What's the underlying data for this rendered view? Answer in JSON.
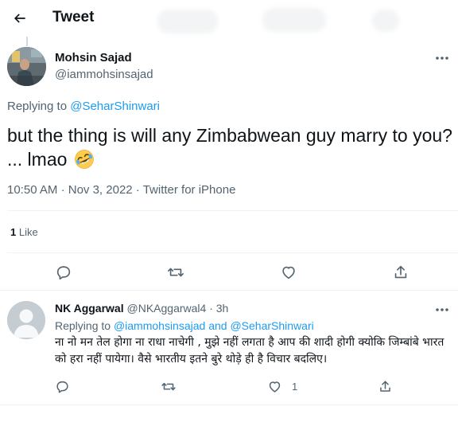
{
  "header": {
    "title": "Tweet"
  },
  "tweet": {
    "author_name": "Mohsin Sajad",
    "author_handle": "@iammohsinsajad",
    "replying_prefix": "Replying to",
    "replying_to": "@SeharShinwari",
    "text_line1": "but the thing is will any Zimbabwean guy marry to you?",
    "text_line2": "... lmao",
    "emoji": "rolling-on-floor-laughing",
    "time": "10:50 AM",
    "date": "Nov 3, 2022",
    "source": "Twitter for iPhone",
    "likes_count": "1",
    "likes_label": "Like"
  },
  "reply": {
    "author_name": "NK Aggarwal",
    "author_handle": "@NKAggarwal4",
    "time": "3h",
    "replying_prefix": "Replying to",
    "replying_to_1": "@iammohsinsajad",
    "replying_and": "and",
    "replying_to_2": "@SeharShinwari",
    "text": "ना नो मन तेल होगा ना राधा नाचेगी , मुझे नहीं लगता है आप की शादी होगी क्योकि जिम्बांबे भारत को हरा नहीं पायेगा। वैसे भारतीय इतने बुरे थोड़े ही है विचार बदलिए।",
    "like_count": "1"
  },
  "colors": {
    "accent": "#1d9bf0",
    "text": "#0f1419",
    "muted": "#536471",
    "border": "#eff3f4"
  }
}
